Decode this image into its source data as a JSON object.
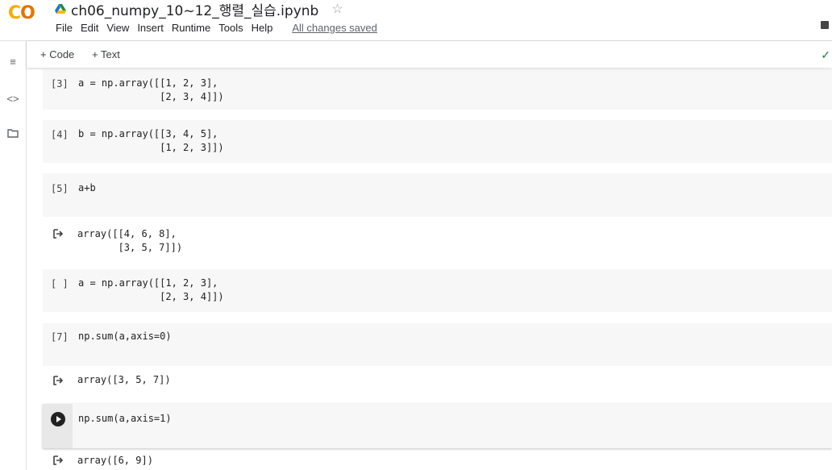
{
  "header": {
    "logo": "CO",
    "title": "ch06_numpy_10~12_행렬_실습.ipynb",
    "star": "☆",
    "menu": [
      "File",
      "Edit",
      "View",
      "Insert",
      "Runtime",
      "Tools",
      "Help"
    ],
    "saved_status": "All changes saved"
  },
  "toolbar": {
    "add_code": "+ Code",
    "add_text": "+ Text",
    "status_check": "✓"
  },
  "sidebar": {
    "toc_icon": "≡",
    "code_icon": "<>",
    "folder_icon": "folder-icon"
  },
  "cells": {
    "c3": {
      "num": "[3]",
      "line1": "a = np.array([[1, 2, 3],",
      "line2": "              [2, 3, 4]])"
    },
    "c4": {
      "num": "[4]",
      "line1": "b = np.array([[3, 4, 5],",
      "line2": "              [1, 2, 3]])"
    },
    "c5": {
      "num": "[5]",
      "line1": "a+b"
    },
    "o5": {
      "line1": "array([[4, 6, 8],",
      "line2": "       [3, 5, 7]])"
    },
    "c6": {
      "num": "[ ]",
      "line1": "a = np.array([[1, 2, 3],",
      "line2": "              [2, 3, 4]])"
    },
    "c7": {
      "num": "[7]",
      "line1": "np.sum(a,axis=0)"
    },
    "o7": {
      "line1": "array([3, 5, 7])"
    },
    "c8": {
      "line1": "np.sum(a,axis=1)"
    },
    "o8": {
      "line1": "array([6, 9])"
    }
  }
}
